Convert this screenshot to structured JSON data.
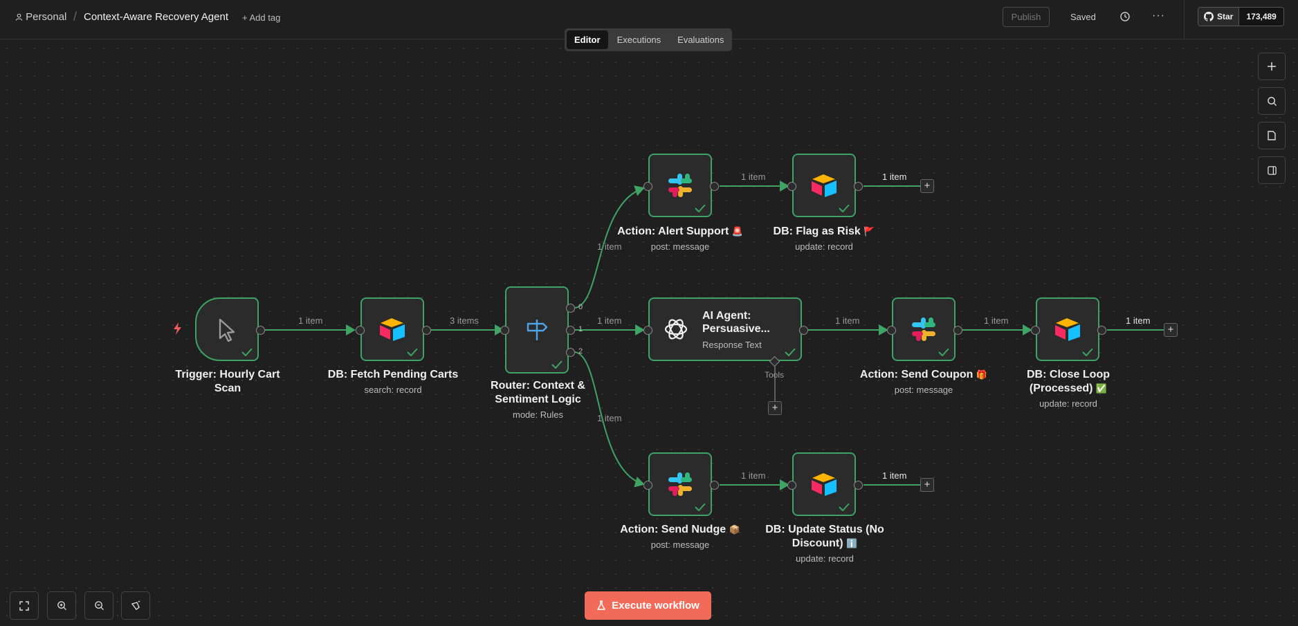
{
  "header": {
    "breadcrumb_personal": "Personal",
    "separator": "/",
    "workflow_title": "Context-Aware Recovery Agent",
    "add_tag": "+ Add tag",
    "publish_label": "Publish",
    "saved_label": "Saved",
    "more_label": "···",
    "github_star": "Star",
    "github_count": "173,489"
  },
  "tabs": [
    {
      "label": "Editor",
      "active": true
    },
    {
      "label": "Executions",
      "active": false
    },
    {
      "label": "Evaluations",
      "active": false
    }
  ],
  "nodes": {
    "trigger": {
      "title": "Trigger: Hourly Cart Scan",
      "icon": "cursor-icon"
    },
    "fetch": {
      "title": "DB: Fetch Pending Carts",
      "subtitle": "search: record",
      "icon": "airtable-icon"
    },
    "router": {
      "title": "Router: Context & Sentiment Logic",
      "subtitle": "mode: Rules",
      "icon": "signpost-icon",
      "outputs": [
        "0",
        "1",
        "2"
      ]
    },
    "alert": {
      "title": "Action: Alert Support",
      "emoji": "🚨",
      "subtitle": "post: message",
      "icon": "slack-icon"
    },
    "flag": {
      "title": "DB: Flag as Risk",
      "emoji": "🚩",
      "subtitle": "update: record",
      "icon": "airtable-icon"
    },
    "agent": {
      "title": "AI Agent: Persuasive...",
      "subtitle": "Response Text",
      "tools_label": "Tools",
      "icon": "openai-icon"
    },
    "coupon": {
      "title": "Action: Send Coupon",
      "emoji": "🎁",
      "subtitle": "post: message",
      "icon": "slack-icon"
    },
    "close": {
      "title": "DB: Close Loop (Processed)",
      "emoji": "✅",
      "subtitle": "update: record",
      "icon": "airtable-icon"
    },
    "nudge": {
      "title": "Action: Send Nudge",
      "emoji": "📦",
      "subtitle": "post: message",
      "icon": "slack-icon"
    },
    "status": {
      "title": "DB: Update Status (No Discount)",
      "emoji": "ℹ️",
      "subtitle": "update: record",
      "icon": "airtable-icon"
    }
  },
  "edges": {
    "trigger_fetch": "1 item",
    "fetch_router": "3 items",
    "router_alert": "1 item",
    "router_agent": "1 item",
    "router_nudge": "1 item",
    "alert_flag": "1 item",
    "flag_out": "1 item",
    "agent_coupon": "1 item",
    "coupon_close": "1 item",
    "close_out": "1 item",
    "nudge_status": "1 item",
    "status_out": "1 item"
  },
  "actions": {
    "execute_label": "Execute workflow"
  },
  "colors": {
    "success_green": "#3fa363",
    "execute_button": "#f26b59",
    "background": "#1f1f1f"
  }
}
